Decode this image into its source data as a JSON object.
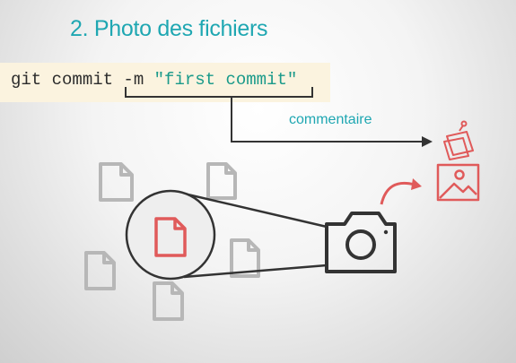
{
  "slide": {
    "title": "2. Photo des fichiers",
    "command": {
      "prefix": "git commit -m ",
      "message": "\"first commit\""
    },
    "annotation": "commentaire"
  },
  "colors": {
    "title": "#1fa7b2",
    "accent_red": "#e05a5a",
    "code_background": "#fbf3df",
    "file_gray": "#b7b7b7",
    "line_dark": "#333333"
  },
  "icons": [
    "file-icon",
    "camera-icon",
    "sticky-note-icon",
    "image-icon",
    "curved-arrow-icon"
  ]
}
